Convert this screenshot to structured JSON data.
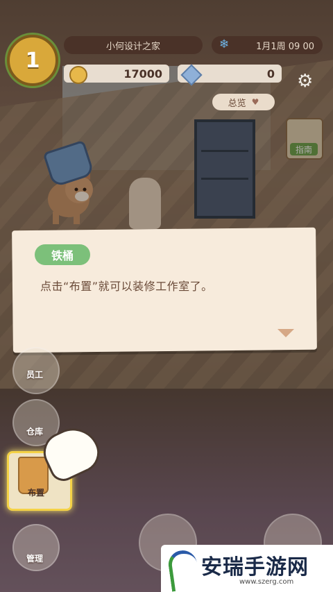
{
  "header": {
    "level": "1",
    "studio_name": "小何设计之家",
    "date": "1月1周  09 00",
    "coins": "17000",
    "gems": "0",
    "overview_label": "总览"
  },
  "guide": {
    "label": "指南"
  },
  "dialog": {
    "speaker": "铁桶",
    "text": "点击“布置”就可以装修工作室了。"
  },
  "side_menu": {
    "staff_label": "员工",
    "warehouse_label": "仓库",
    "layout_label": "布置",
    "manage_label": "管理"
  },
  "watermark": {
    "title": "安瑞手游网",
    "url": "www.szerg.com"
  }
}
